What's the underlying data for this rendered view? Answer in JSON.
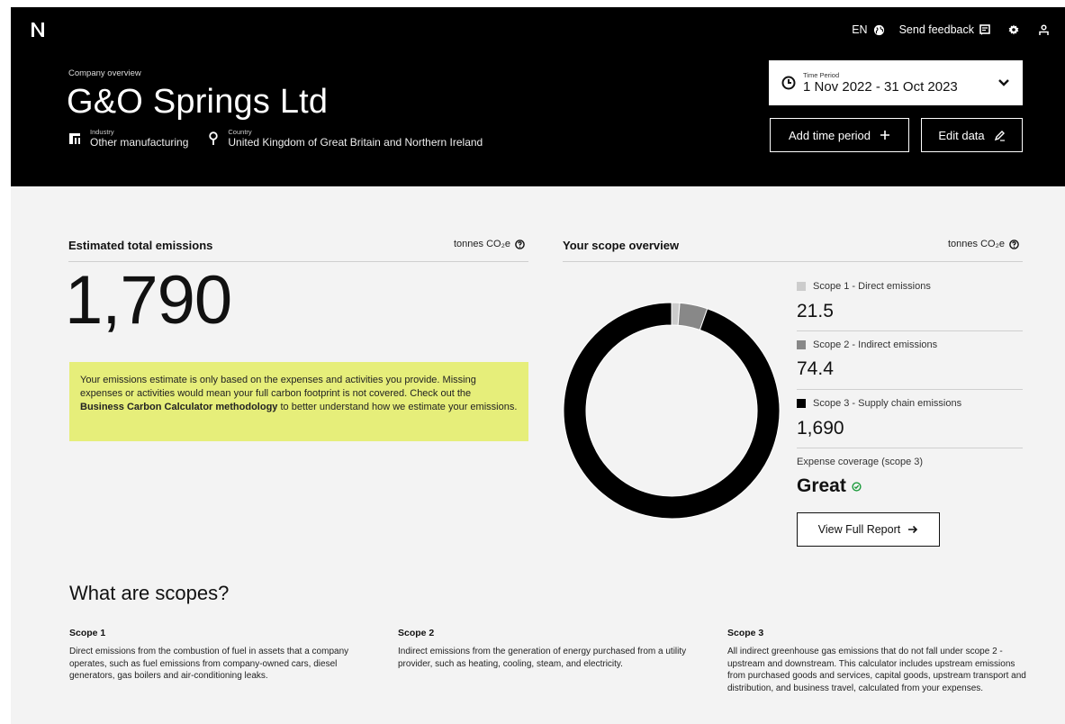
{
  "header": {
    "logo_icon": "brand-n-logo",
    "language": "EN",
    "feedback_label": "Send feedback",
    "breadcrumb": "Company overview",
    "company_name": "G&O Springs Ltd",
    "industry_label": "Industry",
    "industry_value": "Other manufacturing",
    "country_label": "Country",
    "country_value": "United Kingdom of Great Britain and Northern Ireland",
    "period_label": "Time Period",
    "period_value": "1 Nov 2022 - 31 Oct 2023",
    "add_period_label": "Add time period",
    "edit_data_label": "Edit data"
  },
  "emissions": {
    "title": "Estimated total emissions",
    "unit": "tonnes CO₂e",
    "total": "1,790",
    "notice_part1": "Your emissions estimate is only based on the expenses and activities you provide. Missing expenses or activities would mean your full carbon footprint is not covered. Check out the ",
    "notice_link": "Business Carbon Calculator methodology",
    "notice_part2": " to better understand how we estimate your emissions."
  },
  "scopes": {
    "title": "Your scope overview",
    "unit": "tonnes CO₂e",
    "scope1_label": "Scope 1 - Direct emissions",
    "scope1_value": "21.5",
    "scope2_label": "Scope 2 - Indirect emissions",
    "scope2_value": "74.4",
    "scope3_label": "Scope 3 - Supply chain emissions",
    "scope3_value": "1,690",
    "coverage_label": "Expense coverage (scope 3)",
    "coverage_value": "Great",
    "report_button": "View Full Report",
    "colors": {
      "scope1": "#cccccc",
      "scope2": "#888888",
      "scope3": "#000000"
    }
  },
  "info": {
    "heading": "What are scopes?",
    "scope1_title": "Scope 1",
    "scope1_text": "Direct emissions from the combustion of fuel in assets that a company operates, such as fuel emissions from company-owned cars, diesel generators, gas boilers and air-conditioning leaks.",
    "scope2_title": "Scope 2",
    "scope2_text": "Indirect emissions from the generation of energy purchased from a utility provider, such as heating, cooling, steam, and electricity.",
    "scope3_title": "Scope 3",
    "scope3_text": "All indirect greenhouse gas emissions that do not fall under scope 2 - upstream and downstream. This calculator includes upstream emissions from purchased goods and services, capital goods, upstream transport and distribution, and business travel, calculated from your expenses."
  },
  "chart_data": {
    "type": "pie",
    "categories": [
      "Scope 1",
      "Scope 2",
      "Scope 3"
    ],
    "values": [
      21.5,
      74.4,
      1690
    ],
    "colors": [
      "#cccccc",
      "#888888",
      "#000000"
    ],
    "donut": true
  }
}
